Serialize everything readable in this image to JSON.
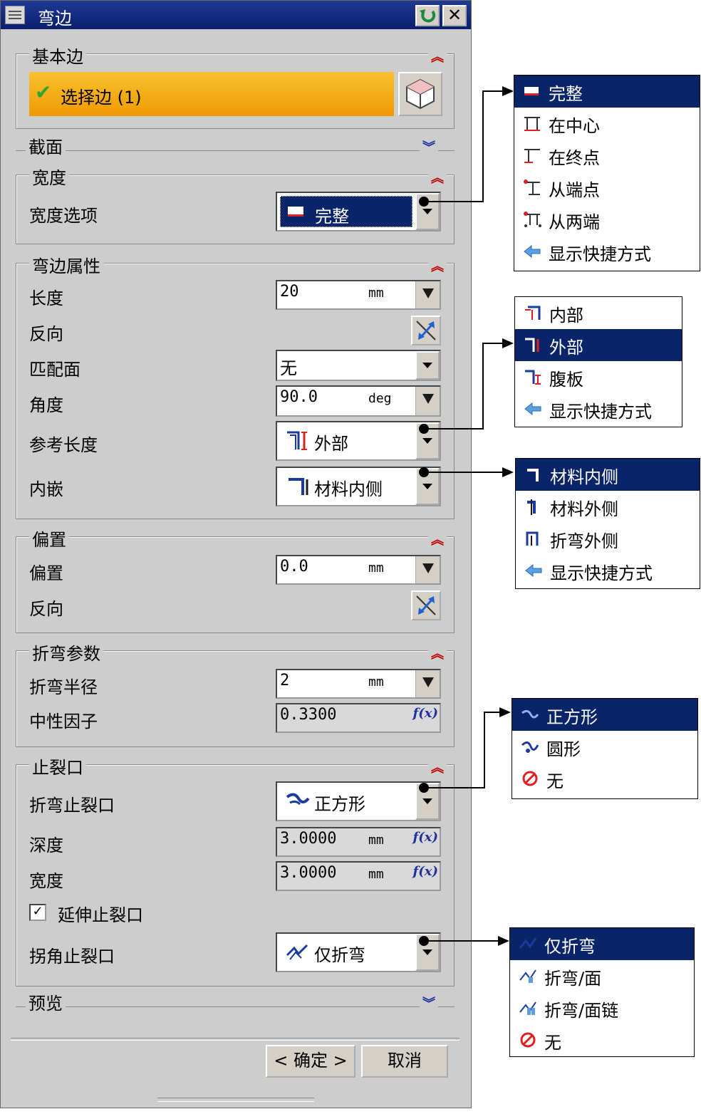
{
  "window": {
    "title": "弯边"
  },
  "groups": {
    "base_edge": {
      "title": "基本边",
      "select_label": "选择边 (1)"
    },
    "section": {
      "title": "截面"
    },
    "width": {
      "title": "宽度",
      "option_label": "宽度选项",
      "option_value": "完整"
    },
    "flange_props": {
      "title": "弯边属性",
      "length_label": "长度",
      "length_value": "20",
      "length_unit": "mm",
      "reverse_label": "反向",
      "match_face_label": "匹配面",
      "match_face_value": "无",
      "angle_label": "角度",
      "angle_value": "90.0",
      "angle_unit": "deg",
      "ref_length_label": "参考长度",
      "ref_length_value": "外部",
      "inset_label": "内嵌",
      "inset_value": "材料内侧"
    },
    "offset": {
      "title": "偏置",
      "offset_label": "偏置",
      "offset_value": "0.0",
      "offset_unit": "mm",
      "reverse_label": "反向"
    },
    "bend_params": {
      "title": "折弯参数",
      "radius_label": "折弯半径",
      "radius_value": "2",
      "radius_unit": "mm",
      "neutral_label": "中性因子",
      "neutral_value": "0.3300"
    },
    "relief": {
      "title": "止裂口",
      "bend_relief_label": "折弯止裂口",
      "bend_relief_value": "正方形",
      "depth_label": "深度",
      "depth_value": "3.0000",
      "depth_unit": "mm",
      "width_label": "宽度",
      "width_value": "3.0000",
      "width_unit": "mm",
      "extend_label": "延伸止裂口",
      "extend_checked": true,
      "corner_relief_label": "拐角止裂口",
      "corner_relief_value": "仅折弯"
    },
    "preview": {
      "title": "预览"
    }
  },
  "buttons": {
    "ok": "< 确定 >",
    "cancel": "取消"
  },
  "popups": {
    "width_options": [
      "完整",
      "在中心",
      "在终点",
      "从端点",
      "从两端",
      "显示快捷方式"
    ],
    "ref_length_options": [
      "内部",
      "外部",
      "腹板",
      "显示快捷方式"
    ],
    "inset_options": [
      "材料内侧",
      "材料外侧",
      "折弯外侧",
      "显示快捷方式"
    ],
    "bend_relief_options": [
      "正方形",
      "圆形",
      "无"
    ],
    "corner_relief_options": [
      "仅折弯",
      "折弯/面",
      "折弯/面链",
      "无"
    ]
  },
  "icons": {
    "check": "check-icon",
    "cube": "cube-icon",
    "reverse": "reverse-direction-icon",
    "fx": "formula-icon",
    "shortcut": "shortcut-arrow-icon",
    "none": "none-icon"
  },
  "colors": {
    "selected": "#0a246a",
    "title_bar": "#0a246a",
    "highlight": "#f5a100",
    "expand_up": "#c00000",
    "expand_down": "#1a2f9a"
  }
}
